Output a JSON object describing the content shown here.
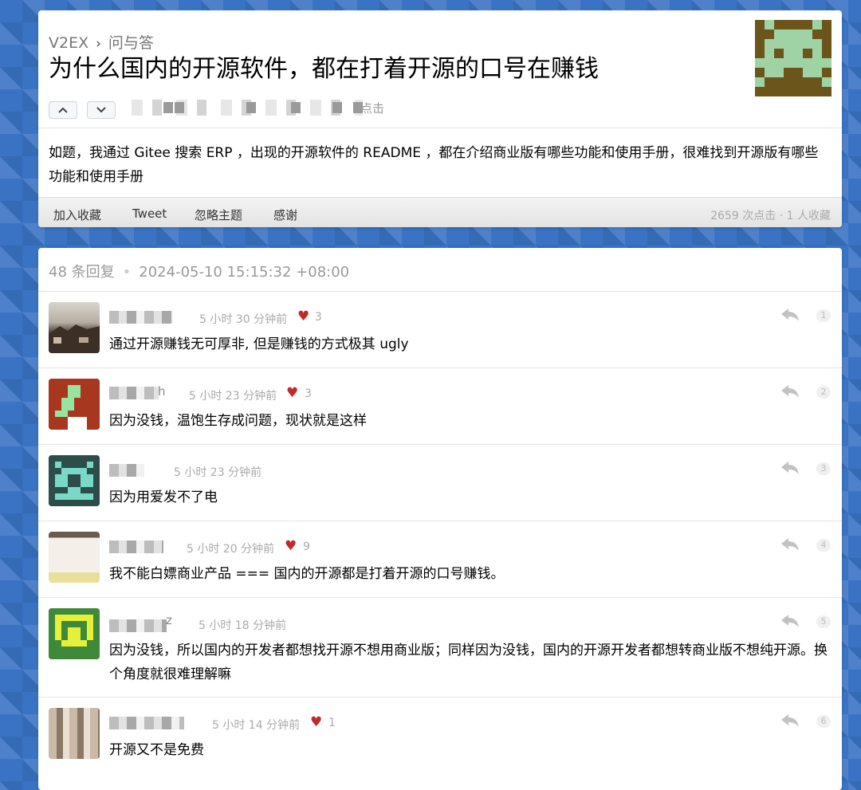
{
  "breadcrumb": {
    "home": "V2EX",
    "separator": "›",
    "node": "问与答"
  },
  "topic": {
    "title": "为什么国内的开源软件，都在打着开源的口号在赚钱",
    "meta_suffix": "点击",
    "content": "如题，我通过 Gitee 搜索 ERP ，出现的开源软件的 README ，都在介绍商业版有哪些功能和使用手册，很难找到开源版有哪些功能和使用手册"
  },
  "footer": {
    "favorite": "加入收藏",
    "tweet": "Tweet",
    "ignore": "忽略主题",
    "thank": "感谢",
    "stats": "2659 次点击 · 1 人收藏"
  },
  "replies_header": {
    "count": "48 条回复",
    "dot": "•",
    "time": "2024-05-10 15:15:32 +08:00"
  },
  "replies": [
    {
      "time": "5 小时 30 分钟前",
      "likes": "3",
      "text": "通过开源赚钱无可厚非, 但是赚钱的方式极其 ugly",
      "floor": "1"
    },
    {
      "time": "5 小时 23 分钟前",
      "likes": "3",
      "text": "因为没钱，温饱生存成问题，现状就是这样",
      "floor": "2",
      "name_suffix": "h"
    },
    {
      "time": "5 小时 23 分钟前",
      "likes": "",
      "text": "因为用爱发不了电",
      "floor": "3"
    },
    {
      "time": "5 小时 20 分钟前",
      "likes": "9",
      "text": "我不能白嫖商业产品 === 国内的开源都是打着开源的口号赚钱。",
      "floor": "4"
    },
    {
      "time": "5 小时 18 分钟前",
      "likes": "",
      "text": "因为没钱，所以国内的开发者都想找开源不想用商业版；同样因为没钱，国内的开源开发者都想转商业版不想纯开源。换个角度就很难理解嘛",
      "floor": "5",
      "name_suffix": "z"
    },
    {
      "time": "5 小时 14 分钟前",
      "likes": "1",
      "text": "开源又不是免费",
      "floor": "6"
    }
  ],
  "icons": {
    "upvote": "chevron-up-icon",
    "downvote": "chevron-down-icon",
    "reply": "reply-icon",
    "heart": "heart-icon"
  }
}
